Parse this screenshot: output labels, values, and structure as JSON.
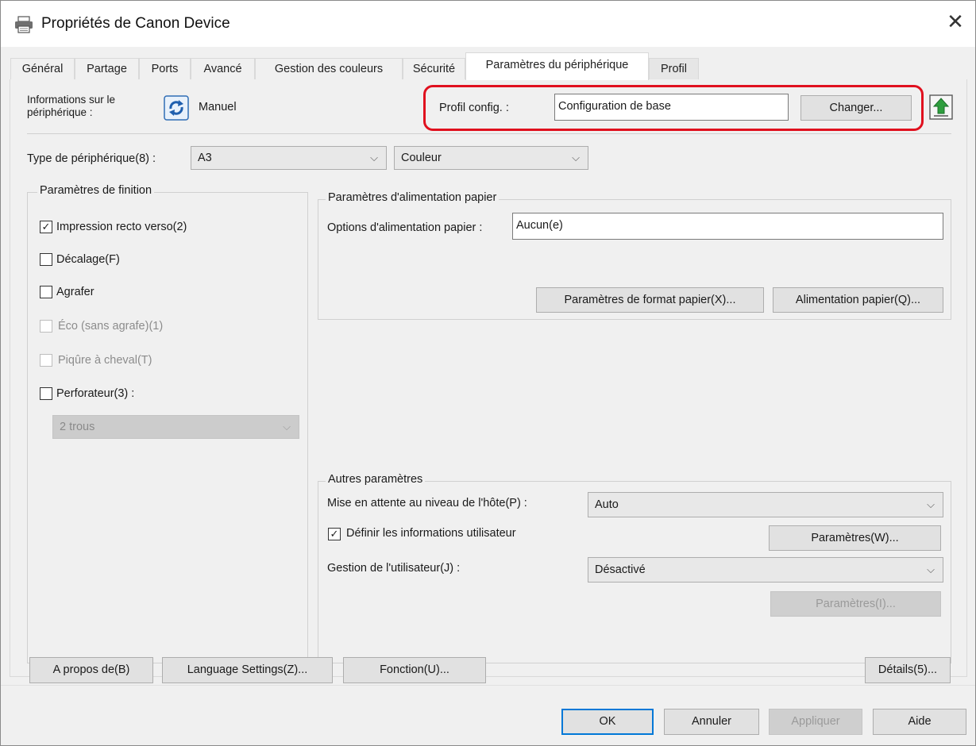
{
  "window": {
    "title": "Propriétés de Canon Device",
    "close_glyph": "✕"
  },
  "tabs": [
    {
      "label": "Général"
    },
    {
      "label": "Partage"
    },
    {
      "label": "Ports"
    },
    {
      "label": "Avancé"
    },
    {
      "label": "Gestion des couleurs"
    },
    {
      "label": "Sécurité"
    },
    {
      "label": "Paramètres du périphérique",
      "active": true
    },
    {
      "label": "Profil"
    }
  ],
  "device_info": {
    "label": "Informations sur le\npériphérique :",
    "mode_text": "Manuel",
    "profile_label": "Profil config. :",
    "profile_value": "Configuration de base",
    "change_button": "Changer..."
  },
  "device_type": {
    "label": "Type de périphérique(8) :",
    "type_value": "A3",
    "color_value": "Couleur"
  },
  "finishing": {
    "title": "Paramètres de finition",
    "options": [
      {
        "label": "Impression recto verso(2)",
        "checked": true,
        "enabled": true
      },
      {
        "label": "Décalage(F)",
        "checked": false,
        "enabled": true
      },
      {
        "label": "Agrafer",
        "checked": false,
        "enabled": true
      },
      {
        "label": "Éco (sans agrafe)(1)",
        "checked": false,
        "enabled": false
      },
      {
        "label": "Piqûre à cheval(T)",
        "checked": false,
        "enabled": false
      },
      {
        "label": "Perforateur(3) :",
        "checked": false,
        "enabled": true
      }
    ],
    "punch_value": "2 trous"
  },
  "paper_feed": {
    "title": "Paramètres d'alimentation papier",
    "options_label": "Options d'alimentation papier :",
    "options_value": "Aucun(e)",
    "format_button": "Paramètres de format papier(X)...",
    "feed_button": "Alimentation papier(Q)..."
  },
  "other": {
    "title": "Autres paramètres",
    "spool_label": "Mise en attente au niveau de l'hôte(P) :",
    "spool_value": "Auto",
    "user_info_label": "Définir les informations utilisateur",
    "user_info_checked": true,
    "user_info_button": "Paramètres(W)...",
    "user_mgmt_label": "Gestion de l'utilisateur(J) :",
    "user_mgmt_value": "Désactivé",
    "user_mgmt_button": "Paramètres(I)..."
  },
  "bottom_buttons": {
    "about": "A propos de(B)",
    "language": "Language Settings(Z)...",
    "function": "Fonction(U)...",
    "details": "Détails(5)..."
  },
  "dialog_buttons": {
    "ok": "OK",
    "cancel": "Annuler",
    "apply": "Appliquer",
    "help": "Aide"
  },
  "colors": {
    "highlight": "#e0101e",
    "accent": "#0078d7"
  },
  "icons": {
    "printer": "printer-icon",
    "refresh": "refresh-icon",
    "upload": "upload-icon",
    "check": "✓",
    "chevron": "⌵"
  }
}
